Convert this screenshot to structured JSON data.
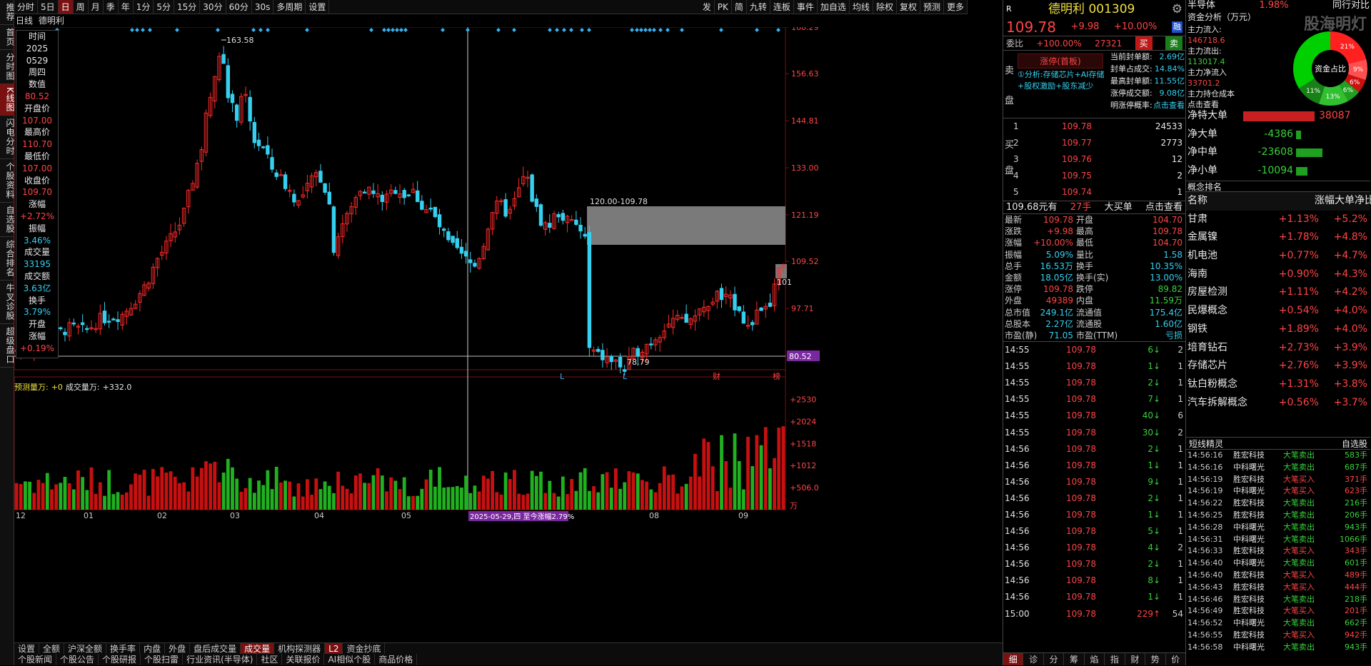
{
  "left_rail": [
    "推荐",
    "首页",
    "分时图",
    "K线图",
    "闪电分时",
    "个股资料",
    "自选股",
    "综合排名",
    "牛叉诊股",
    "超级盘口"
  ],
  "toolbar": {
    "items": [
      "分时",
      "5日",
      "日",
      "周",
      "月",
      "季",
      "年",
      "1分",
      "5分",
      "15分",
      "30分",
      "60分",
      "30s",
      "多周期",
      "设置"
    ],
    "right": [
      "发",
      "PK",
      "简",
      "九转",
      "连板",
      "事件",
      "加自选",
      "均线",
      "除权",
      "复权",
      "预测",
      "更多"
    ]
  },
  "chart_header": {
    "period": "日线",
    "name": "德明利"
  },
  "info": [
    {
      "k": "时间",
      "v": "2025"
    },
    {
      "k": "",
      "v": "0529"
    },
    {
      "k": "",
      "v": "周四"
    },
    {
      "k": "数值",
      "v": "80.52",
      "c": "red"
    },
    {
      "k": "开盘价",
      "v": "107.00",
      "c": "red"
    },
    {
      "k": "最高价",
      "v": "110.70",
      "c": "red"
    },
    {
      "k": "最低价",
      "v": "107.00",
      "c": "red"
    },
    {
      "k": "收盘价",
      "v": "109.70",
      "c": "red"
    },
    {
      "k": "涨幅",
      "v": "+2.72%",
      "c": "red"
    },
    {
      "k": "振幅",
      "v": "3.46%",
      "c": "cy"
    },
    {
      "k": "成交量",
      "v": "33195",
      "c": "cy"
    },
    {
      "k": "成交额",
      "v": "3.63亿",
      "c": "cy"
    },
    {
      "k": "换手",
      "v": "3.79%",
      "c": "cy"
    },
    {
      "k": "开盘",
      "v": ""
    },
    {
      "k": "涨幅",
      "v": "+0.19%",
      "c": "red"
    }
  ],
  "chart_data": {
    "type": "candlestick",
    "price_axis": [
      "168.29",
      "156.63",
      "144.81",
      "133.00",
      "121.19",
      "109.52",
      "97.71",
      "85.89"
    ],
    "price_axis_top": 168.29,
    "price_axis_bottom": 85.89,
    "current_price_tag": "80.52",
    "annotations": {
      "high": "163.58",
      "low": "78.79",
      "range": "120.00-109.78",
      "right_edge": "101"
    },
    "x_labels": [
      "12",
      "01",
      "02",
      "03",
      "04",
      "05",
      "08",
      "09"
    ],
    "crosshair_label": "2025-05-29,四 至今涨幅2.79%",
    "event_markers": [
      "L",
      "L",
      "财",
      "榜"
    ],
    "volume_legend": {
      "pred_label": "预测量万:",
      "pred": "+0",
      "vol_label": "成交量万:",
      "vol": "+332.0"
    },
    "volume_axis": [
      "+2530",
      "+2024",
      "+1518",
      "+1012",
      "+506.0",
      "万"
    ]
  },
  "bottom_tabs": [
    "设置",
    "全额",
    "沪深全额",
    "换手率",
    "内盘",
    "外盘",
    "盘后成交量",
    "成交量",
    "机构探测器",
    "L2",
    "资金抄底"
  ],
  "bottom_links": [
    "个股新闻",
    "个股公告",
    "个股研报",
    "个股扫雷",
    "行业资讯(半导体)",
    "社区",
    "关联报价",
    "AI相似个股",
    "商品价格"
  ],
  "quote": {
    "name": "德明利",
    "code": "001309",
    "price": "109.78",
    "change": "+9.98",
    "pct": "+10.00%",
    "tag": "融",
    "weibi_label": "委比",
    "weibi": "+100.00%",
    "weibi_num": "27321",
    "buy_btn": "买",
    "sell_btn": "卖",
    "limit_status": "涨停(首板)",
    "analysis": "①分析:存储芯片+AI存储+股权激励+股东减少",
    "limit_info": [
      {
        "k": "当前封单额:",
        "v": "2.69亿"
      },
      {
        "k": "封单占成交:",
        "v": "14.84%"
      },
      {
        "k": "最高封单额:",
        "v": "11.55亿"
      },
      {
        "k": "涨停成交额:",
        "v": "9.08亿"
      },
      {
        "k": "明涨停概率:",
        "v": "点击查看"
      }
    ],
    "sell_label": "卖盘",
    "buy_label": "买盘",
    "bids": [
      {
        "lv": "1",
        "p": "109.78",
        "v": "24533"
      },
      {
        "lv": "2",
        "p": "109.77",
        "v": "2773"
      },
      {
        "lv": "3",
        "p": "109.76",
        "v": "12"
      },
      {
        "lv": "4",
        "p": "109.75",
        "v": "2"
      },
      {
        "lv": "5",
        "p": "109.74",
        "v": "1"
      }
    ],
    "big_buy": {
      "p": "109.68元有",
      "v": "27手",
      "label": "大买单",
      "link": "点击查看"
    },
    "stats": [
      [
        "最新",
        "109.78",
        "开盘",
        "104.70"
      ],
      [
        "涨跌",
        "+9.98",
        "最高",
        "109.78"
      ],
      [
        "涨幅",
        "+10.00%",
        "最低",
        "104.70"
      ],
      [
        "振幅",
        "5.09%",
        "量比",
        "1.58"
      ],
      [
        "总手",
        "16.53万",
        "换手",
        "10.35%"
      ],
      [
        "金额",
        "18.05亿",
        "换手(实)",
        "13.00%"
      ],
      [
        "涨停",
        "109.78",
        "跌停",
        "89.82"
      ],
      [
        "外盘",
        "49389",
        "内盘",
        "11.59万"
      ],
      [
        "总市值",
        "249.1亿",
        "流通值",
        "175.4亿"
      ],
      [
        "总股本",
        "2.27亿",
        "流通股",
        "1.60亿"
      ],
      [
        "市盈(静)",
        "71.05",
        "市盈(TTM)",
        "亏损"
      ]
    ],
    "ticks": [
      {
        "t": "14:55",
        "p": "109.78",
        "v": "6",
        "d": "d",
        "n": "2"
      },
      {
        "t": "14:55",
        "p": "109.78",
        "v": "1",
        "d": "d",
        "n": "1"
      },
      {
        "t": "14:55",
        "p": "109.78",
        "v": "2",
        "d": "d",
        "n": "1"
      },
      {
        "t": "14:55",
        "p": "109.78",
        "v": "7",
        "d": "d",
        "n": "1"
      },
      {
        "t": "14:55",
        "p": "109.78",
        "v": "40",
        "d": "d",
        "n": "6"
      },
      {
        "t": "14:55",
        "p": "109.78",
        "v": "30",
        "d": "d",
        "n": "2"
      },
      {
        "t": "14:56",
        "p": "109.78",
        "v": "2",
        "d": "d",
        "n": "1"
      },
      {
        "t": "14:56",
        "p": "109.78",
        "v": "1",
        "d": "d",
        "n": "1"
      },
      {
        "t": "14:56",
        "p": "109.78",
        "v": "9",
        "d": "d",
        "n": "1"
      },
      {
        "t": "14:56",
        "p": "109.78",
        "v": "2",
        "d": "d",
        "n": "1"
      },
      {
        "t": "14:56",
        "p": "109.78",
        "v": "1",
        "d": "d",
        "n": "1"
      },
      {
        "t": "14:56",
        "p": "109.78",
        "v": "5",
        "d": "d",
        "n": "1"
      },
      {
        "t": "14:56",
        "p": "109.78",
        "v": "4",
        "d": "d",
        "n": "2"
      },
      {
        "t": "14:56",
        "p": "109.78",
        "v": "2",
        "d": "d",
        "n": "1"
      },
      {
        "t": "14:56",
        "p": "109.78",
        "v": "8",
        "d": "d",
        "n": "1"
      },
      {
        "t": "14:56",
        "p": "109.78",
        "v": "1",
        "d": "d",
        "n": "1"
      },
      {
        "t": "15:00",
        "p": "109.78",
        "v": "229",
        "d": "u",
        "n": "54"
      }
    ],
    "bottom_icons": [
      "细",
      "诊",
      "分",
      "筹",
      "焰",
      "指",
      "财",
      "势",
      "价"
    ]
  },
  "fund": {
    "sector": "半导体",
    "sector_pct": "1.98%",
    "sector_link": "同行对比",
    "title": "资金分析（万元）",
    "logo": "股海明灯",
    "flows": [
      {
        "k": "主力流入:",
        "v": "146718.6",
        "c": "red"
      },
      {
        "k": "主力流出:",
        "v": "113017.4",
        "c": "grn"
      },
      {
        "k": "主力净流入",
        "v": "33701.2",
        "c": "red"
      },
      {
        "k": "主力持仓成本",
        "v": ""
      },
      {
        "k": "点击查看",
        "v": ""
      }
    ],
    "donut": {
      "center": "资金占比",
      "slices": [
        {
          "label": "21%",
          "value": 21,
          "color": "#ff2020"
        },
        {
          "label": "9%",
          "value": 9,
          "color": "#ff5050"
        },
        {
          "label": "6%",
          "value": 6,
          "color": "#cc1010"
        },
        {
          "label": "6%",
          "value": 6,
          "color": "#20a020"
        },
        {
          "label": "13%",
          "value": 13,
          "color": "#30c030"
        },
        {
          "label": "11%",
          "value": 11,
          "color": "#178017"
        },
        {
          "label": "",
          "value": 34,
          "color": "#00d000"
        }
      ]
    },
    "net": [
      {
        "k": "净特大单",
        "v": "38087",
        "c": "red",
        "w": 1.0
      },
      {
        "k": "净大单",
        "v": "-4386",
        "c": "grn",
        "w": 0.12
      },
      {
        "k": "净中单",
        "v": "-23608",
        "c": "grn",
        "w": 0.62
      },
      {
        "k": "净小单",
        "v": "-10094",
        "c": "grn",
        "w": 0.27
      }
    ],
    "rank_title": "概念排名",
    "rank_cols": [
      "名称",
      "涨幅",
      "大单净比"
    ],
    "rank": [
      [
        "甘肃",
        "+1.13%",
        "+5.2%"
      ],
      [
        "金属镍",
        "+1.78%",
        "+4.8%"
      ],
      [
        "机电池",
        "+0.77%",
        "+4.7%"
      ],
      [
        "海南",
        "+0.90%",
        "+4.3%"
      ],
      [
        "房屋检测",
        "+1.11%",
        "+4.2%"
      ],
      [
        "民爆概念",
        "+0.54%",
        "+4.0%"
      ],
      [
        "钢铁",
        "+1.89%",
        "+4.0%"
      ],
      [
        "培育钻石",
        "+2.73%",
        "+3.9%"
      ],
      [
        "存储芯片",
        "+2.76%",
        "+3.9%"
      ],
      [
        "钛白粉概念",
        "+1.31%",
        "+3.8%"
      ],
      [
        "汽车拆解概念",
        "+0.56%",
        "+3.7%"
      ]
    ],
    "elf_title": "短线精灵",
    "elf_tab": "自选股",
    "deals": [
      [
        "14:56:16",
        "胜宏科技",
        "大笔卖出",
        "583手",
        "g"
      ],
      [
        "14:56:16",
        "中科曙光",
        "大笔卖出",
        "687手",
        "g"
      ],
      [
        "14:56:19",
        "胜宏科技",
        "大笔买入",
        "371手",
        "r"
      ],
      [
        "14:56:19",
        "中科曙光",
        "大笔买入",
        "623手",
        "r"
      ],
      [
        "14:56:22",
        "胜宏科技",
        "大笔卖出",
        "216手",
        "g"
      ],
      [
        "14:56:25",
        "胜宏科技",
        "大笔卖出",
        "206手",
        "g"
      ],
      [
        "14:56:28",
        "中科曙光",
        "大笔卖出",
        "943手",
        "g"
      ],
      [
        "14:56:31",
        "中科曙光",
        "大笔卖出",
        "1066手",
        "g"
      ],
      [
        "14:56:33",
        "胜宏科技",
        "大笔买入",
        "343手",
        "r"
      ],
      [
        "14:56:40",
        "中科曙光",
        "大笔卖出",
        "601手",
        "g"
      ],
      [
        "14:56:40",
        "胜宏科技",
        "大笔买入",
        "489手",
        "r"
      ],
      [
        "14:56:43",
        "胜宏科技",
        "大笔买入",
        "444手",
        "r"
      ],
      [
        "14:56:46",
        "胜宏科技",
        "大笔卖出",
        "218手",
        "g"
      ],
      [
        "14:56:49",
        "胜宏科技",
        "大笔买入",
        "201手",
        "r"
      ],
      [
        "14:56:52",
        "中科曙光",
        "大笔卖出",
        "662手",
        "g"
      ],
      [
        "14:56:55",
        "胜宏科技",
        "大笔买入",
        "942手",
        "r"
      ],
      [
        "14:56:58",
        "中科曙光",
        "大笔卖出",
        "943手",
        "g"
      ]
    ]
  }
}
